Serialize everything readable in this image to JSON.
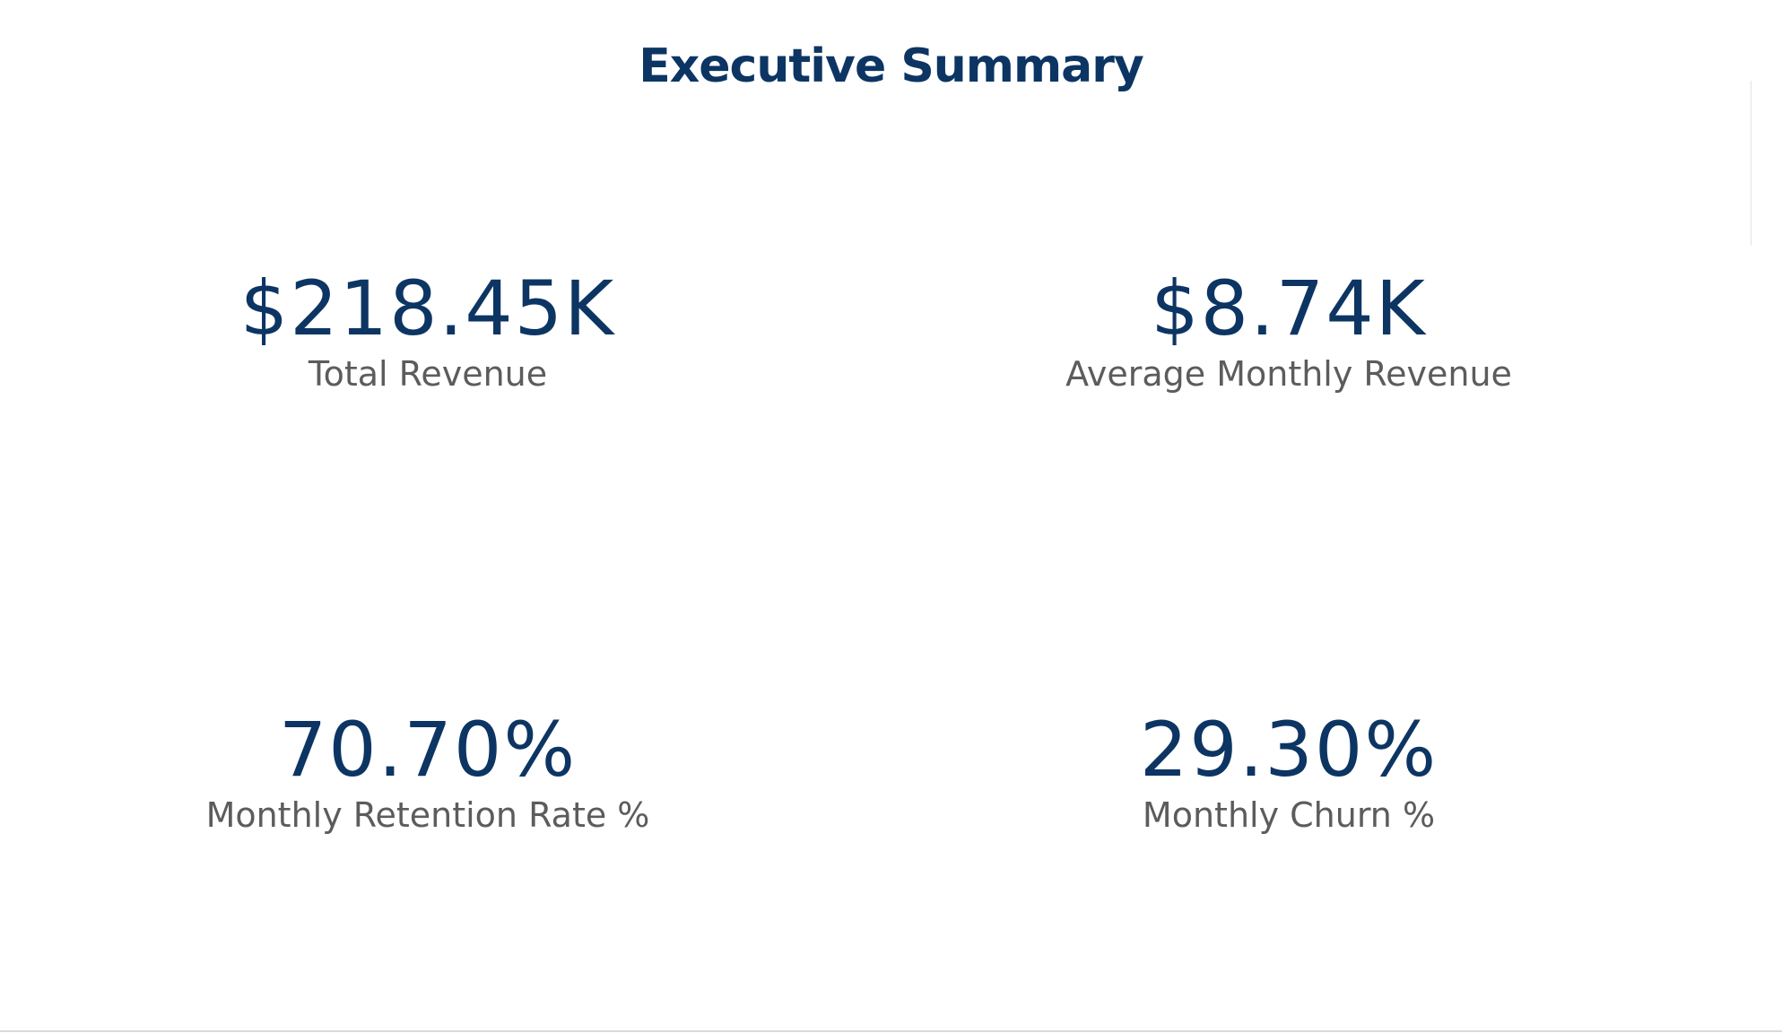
{
  "title": "Executive Summary",
  "colors": {
    "value": "#0d3563",
    "label": "#5c5c5c",
    "background": "#ffffff"
  },
  "kpis": [
    {
      "value": "$218.45K",
      "label": "Total Revenue"
    },
    {
      "value": "$8.74K",
      "label": "Average Monthly Revenue"
    },
    {
      "value": "70.70%",
      "label": "Monthly Retention Rate %"
    },
    {
      "value": "29.30%",
      "label": "Monthly Churn %"
    }
  ]
}
